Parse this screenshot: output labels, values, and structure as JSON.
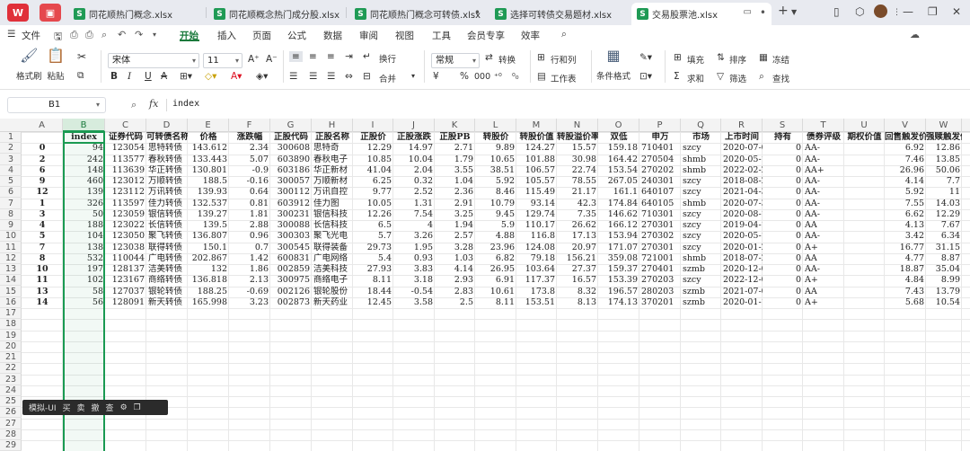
{
  "tabs": [
    {
      "label": "同花顺热门概念.xlsx",
      "active": false
    },
    {
      "label": "同花顺概念热门成分股.xlsx",
      "active": false
    },
    {
      "label": "同花顺热门概念可转债.xlsx",
      "active": false
    },
    {
      "label": "选择可转债交易题材.xlsx",
      "active": false
    },
    {
      "label": "交易股票池.xlsx",
      "active": true
    }
  ],
  "menu": {
    "file": "文件",
    "items": [
      "开始",
      "插入",
      "页面",
      "公式",
      "数据",
      "审阅",
      "视图",
      "工具",
      "会员专享",
      "效率"
    ],
    "active": "开始",
    "share": "分享"
  },
  "ribbon": {
    "format_painter": "格式刷",
    "paste": "粘贴",
    "font_name": "宋体",
    "font_size": "11",
    "wrap": "换行",
    "merge": "合并",
    "number_format": "常规",
    "convert": "转换",
    "rows_cols": "行和列",
    "worksheet": "工作表",
    "cond_format": "条件格式",
    "fill": "填充",
    "sort": "排序",
    "freeze": "冻结",
    "sum": "求和",
    "filter": "筛选",
    "find": "查找",
    "bold": "B",
    "italic": "I",
    "underline": "U",
    "strike": "A",
    "currency": "¥",
    "percent": "%",
    "thousands": "000"
  },
  "formula_bar": {
    "cell_ref": "B1",
    "fx": "fx",
    "value": "index"
  },
  "columns": [
    "A",
    "B",
    "C",
    "D",
    "E",
    "F",
    "G",
    "H",
    "I",
    "J",
    "K",
    "L",
    "M",
    "N",
    "O",
    "P",
    "Q",
    "R",
    "S",
    "T",
    "U",
    "V",
    "W"
  ],
  "headers": [
    "",
    "index",
    "证券代码",
    "可转债名称",
    "价格",
    "涨跌幅",
    "正股代码",
    "正股名称",
    "正股价",
    "正股涨跌",
    "正股PB",
    "转股价",
    "转股价值",
    "转股溢价率",
    "双低",
    "申万",
    "市场",
    "上市时间",
    "持有",
    "债券评级",
    "期权价值",
    "回售触发价",
    "强赎触发价"
  ],
  "rows": [
    [
      "0",
      "94",
      "123054",
      "思特转债",
      "143.612",
      "2.34",
      "300608",
      "思特奇",
      "12.29",
      "14.97",
      "2.71",
      "9.89",
      "124.27",
      "15.57",
      "159.18",
      "710401",
      "szcy",
      "2020-07-0",
      "0",
      "AA-",
      "",
      "6.92",
      "12.86"
    ],
    [
      "2",
      "242",
      "113577",
      "春秋转债",
      "133.443",
      "5.07",
      "603890",
      "春秋电子",
      "10.85",
      "10.04",
      "1.79",
      "10.65",
      "101.88",
      "30.98",
      "164.42",
      "270504",
      "shmb",
      "2020-05-1",
      "0",
      "AA-",
      "",
      "7.46",
      "13.85"
    ],
    [
      "6",
      "148",
      "113639",
      "华正转债",
      "130.801",
      "-0.9",
      "603186",
      "华正新材",
      "41.04",
      "2.04",
      "3.55",
      "38.51",
      "106.57",
      "22.74",
      "153.54",
      "270202",
      "shmb",
      "2022-02-2",
      "0",
      "AA+",
      "",
      "26.96",
      "50.06"
    ],
    [
      "9",
      "460",
      "123012",
      "万顺转债",
      "188.5",
      "-0.16",
      "300057",
      "万顺新材",
      "6.25",
      "0.32",
      "1.04",
      "5.92",
      "105.57",
      "78.55",
      "267.05",
      "240301",
      "szcy",
      "2018-08-2",
      "0",
      "AA-",
      "",
      "4.14",
      "7.7"
    ],
    [
      "12",
      "139",
      "123112",
      "万讯转债",
      "139.93",
      "0.64",
      "300112",
      "万讯自控",
      "9.77",
      "2.52",
      "2.36",
      "8.46",
      "115.49",
      "21.17",
      "161.1",
      "640107",
      "szcy",
      "2021-04-3",
      "0",
      "AA-",
      "",
      "5.92",
      "11"
    ],
    [
      "1",
      "326",
      "113597",
      "佳力转债",
      "132.537",
      "0.81",
      "603912",
      "佳力图",
      "10.05",
      "1.31",
      "2.91",
      "10.79",
      "93.14",
      "42.3",
      "174.84",
      "640105",
      "shmb",
      "2020-07-3",
      "0",
      "AA-",
      "",
      "7.55",
      "14.03"
    ],
    [
      "3",
      "50",
      "123059",
      "银信转债",
      "139.27",
      "1.81",
      "300231",
      "银信科技",
      "12.26",
      "7.54",
      "3.25",
      "9.45",
      "129.74",
      "7.35",
      "146.62",
      "710301",
      "szcy",
      "2020-08-1",
      "0",
      "AA-",
      "",
      "6.62",
      "12.29"
    ],
    [
      "4",
      "188",
      "123022",
      "长信转债",
      "139.5",
      "2.88",
      "300088",
      "长信科技",
      "6.5",
      "4",
      "1.94",
      "5.9",
      "110.17",
      "26.62",
      "166.12",
      "270301",
      "szcy",
      "2019-04-1",
      "0",
      "AA",
      "",
      "4.13",
      "7.67"
    ],
    [
      "5",
      "104",
      "123050",
      "聚飞转债",
      "136.807",
      "0.96",
      "300303",
      "聚飞光电",
      "5.7",
      "3.26",
      "2.57",
      "4.88",
      "116.8",
      "17.13",
      "153.94",
      "270302",
      "szcy",
      "2020-05-1",
      "0",
      "AA-",
      "",
      "3.42",
      "6.34"
    ],
    [
      "7",
      "138",
      "123038",
      "联得转债",
      "150.1",
      "0.7",
      "300545",
      "联得装备",
      "29.73",
      "1.95",
      "3.28",
      "23.96",
      "124.08",
      "20.97",
      "171.07",
      "270301",
      "szcy",
      "2020-01-2",
      "0",
      "A+",
      "",
      "16.77",
      "31.15"
    ],
    [
      "8",
      "532",
      "110044",
      "广电转债",
      "202.867",
      "1.42",
      "600831",
      "广电网络",
      "5.4",
      "0.93",
      "1.03",
      "6.82",
      "79.18",
      "156.21",
      "359.08",
      "721001",
      "shmb",
      "2018-07-2",
      "0",
      "AA",
      "",
      "4.77",
      "8.87"
    ],
    [
      "10",
      "197",
      "128137",
      "洁美转债",
      "132",
      "1.86",
      "002859",
      "洁美科技",
      "27.93",
      "3.83",
      "4.14",
      "26.95",
      "103.64",
      "27.37",
      "159.37",
      "270401",
      "szmb",
      "2020-12-0",
      "0",
      "AA-",
      "",
      "18.87",
      "35.04"
    ],
    [
      "11",
      "102",
      "123167",
      "商络转债",
      "136.818",
      "2.13",
      "300975",
      "商络电子",
      "8.11",
      "3.18",
      "2.93",
      "6.91",
      "117.37",
      "16.57",
      "153.39",
      "270203",
      "szcy",
      "2022-12-0",
      "0",
      "A+",
      "",
      "4.84",
      "8.99"
    ],
    [
      "13",
      "58",
      "127037",
      "银轮转债",
      "188.25",
      "-0.69",
      "002126",
      "银轮股份",
      "18.44",
      "-0.54",
      "2.83",
      "10.61",
      "173.8",
      "8.32",
      "196.57",
      "280203",
      "szmb",
      "2021-07-0",
      "0",
      "AA",
      "",
      "7.43",
      "13.79"
    ],
    [
      "14",
      "56",
      "128091",
      "新天转债",
      "165.998",
      "3.23",
      "002873",
      "新天药业",
      "12.45",
      "3.58",
      "2.5",
      "8.11",
      "153.51",
      "8.13",
      "174.13",
      "370201",
      "szmb",
      "2020-01-1",
      "0",
      "A+",
      "",
      "5.68",
      "10.54"
    ]
  ],
  "row_numbers": [
    "1",
    "2",
    "3",
    "4",
    "5",
    "6",
    "7",
    "8",
    "9",
    "10",
    "11",
    "12",
    "13",
    "14",
    "15",
    "16",
    "17",
    "18",
    "19",
    "20",
    "21",
    "22",
    "23",
    "24",
    "25",
    "26",
    "27",
    "28",
    "29"
  ],
  "float_toolbar": [
    "模拟-UI",
    "买",
    "卖",
    "撤",
    "查",
    "⚙",
    "❐"
  ]
}
